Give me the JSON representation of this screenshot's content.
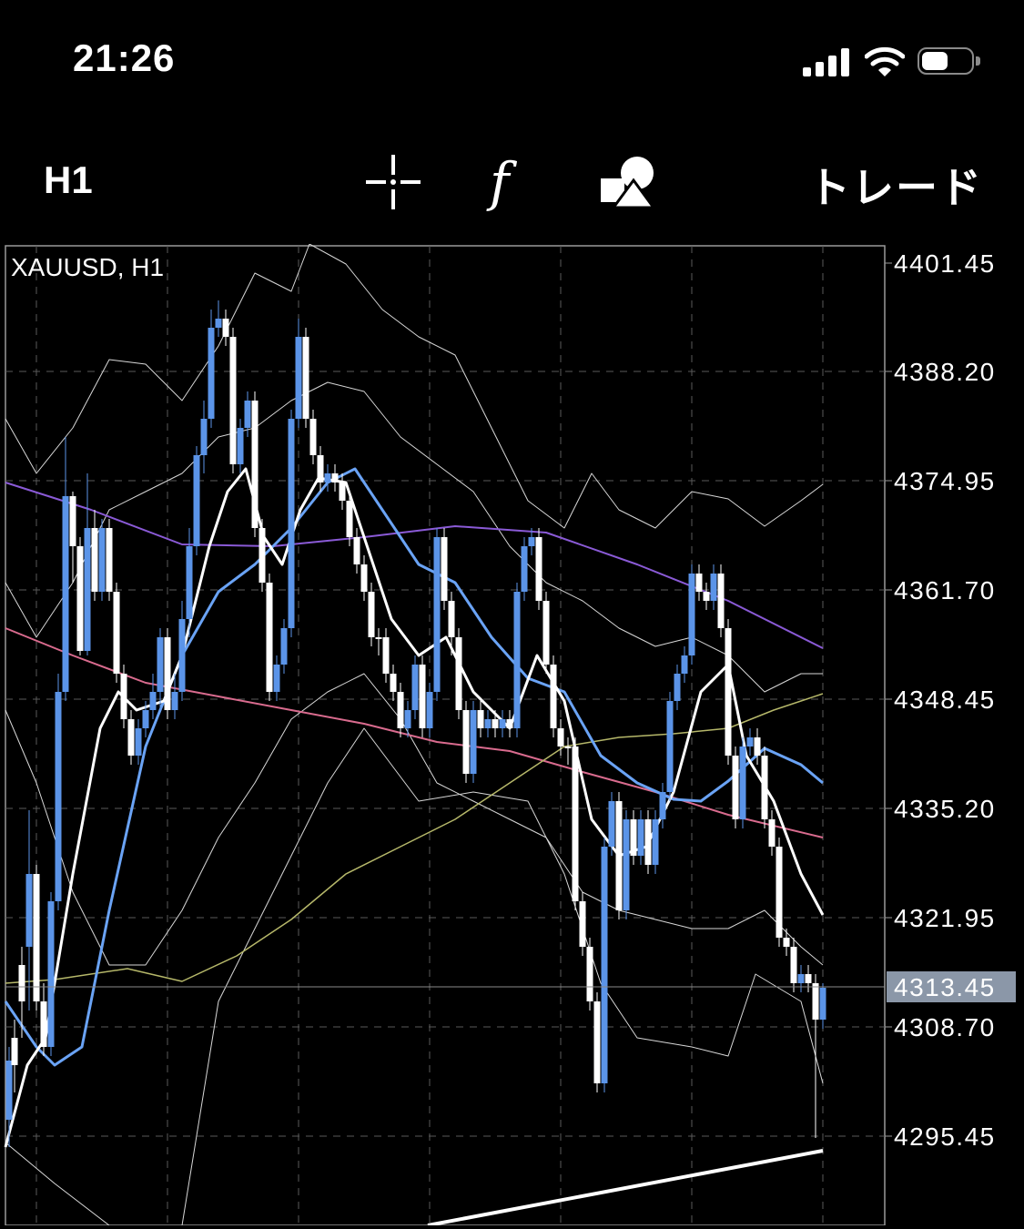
{
  "status_bar": {
    "time": "21:26"
  },
  "toolbar": {
    "timeframe": "H1",
    "crosshair_icon": "crosshair-icon",
    "indicators_icon": "function-icon",
    "objects_icon": "shapes-icon",
    "trade_label": "トレード"
  },
  "chart": {
    "symbol_label": "XAUUSD, H1",
    "current_price": "4313.45",
    "price_scale": [
      "4401.45",
      "4388.20",
      "4374.95",
      "4361.70",
      "4348.45",
      "4335.20",
      "4321.95",
      "4308.70",
      "4295.45"
    ],
    "colors": {
      "background": "#000000",
      "bull_candle": "#ffffff",
      "bear_candle": "#5b94e8",
      "ma_fast": "#ffffff",
      "ma_mid": "#6aa3f5",
      "ma_purple": "#8a5ad6",
      "ma_pink": "#d96b8e",
      "ma_yellow": "#b6b86a",
      "bands": "#d8d8d8",
      "grid": "#5a5a5a",
      "price_tag": "#8b97a8"
    }
  }
}
